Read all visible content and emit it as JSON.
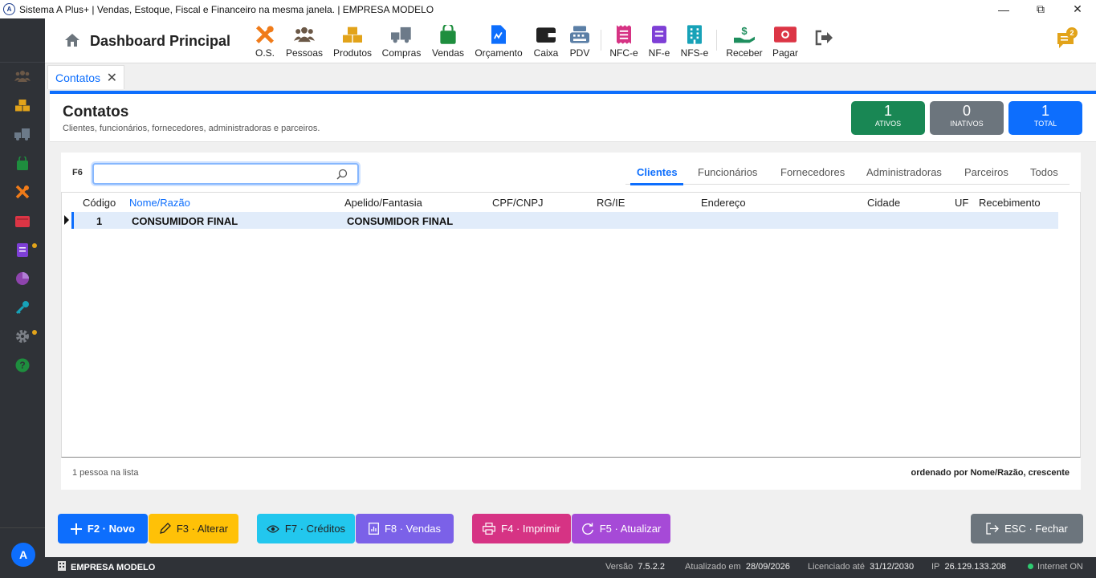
{
  "window": {
    "title": "Sistema A Plus+ | Vendas, Estoque, Fiscal e Financeiro na mesma janela. | EMPRESA MODELO",
    "minimize": "—",
    "maximize": "⧉",
    "close": "✕"
  },
  "header": {
    "title": "Dashboard Principal",
    "toolbar": [
      {
        "label": "O.S.",
        "icon": "tools-icon",
        "color": "#f07b19"
      },
      {
        "label": "Pessoas",
        "icon": "people-icon",
        "color": "#6b5847"
      },
      {
        "label": "Produtos",
        "icon": "boxes-icon",
        "color": "#e2a31a"
      },
      {
        "label": "Compras",
        "icon": "truck-icon",
        "color": "#6c7a89"
      },
      {
        "label": "Vendas",
        "icon": "shopping-bag-icon",
        "color": "#1e8e3e"
      },
      {
        "label": "Orçamento",
        "icon": "file-chart-icon",
        "color": "#0d6efd"
      },
      {
        "label": "Caixa",
        "icon": "wallet-icon",
        "color": "#222222"
      },
      {
        "label": "PDV",
        "icon": "cash-register-icon",
        "color": "#5b7fa6"
      },
      {
        "label": "NFC-e",
        "icon": "receipt-icon",
        "color": "#d63384"
      },
      {
        "label": "NF-e",
        "icon": "document-icon",
        "color": "#7e3fd6"
      },
      {
        "label": "NFS-e",
        "icon": "building-icon",
        "color": "#17a2b8"
      },
      {
        "label": "Receber",
        "icon": "hand-dollar-icon",
        "color": "#1e8e5e"
      },
      {
        "label": "Pagar",
        "icon": "money-icon",
        "color": "#dc3545"
      }
    ],
    "notifications_count": "2"
  },
  "tab": {
    "label": "Contatos",
    "close": "✕"
  },
  "page": {
    "title": "Contatos",
    "subtitle": "Clientes, funcionários, fornecedores, administradoras e parceiros.",
    "stats": [
      {
        "value": "1",
        "caption": "ATIVOS",
        "color": "#198754"
      },
      {
        "value": "0",
        "caption": "INATIVOS",
        "color": "#6c757d"
      },
      {
        "value": "1",
        "caption": "TOTAL",
        "color": "#0d6efd"
      }
    ]
  },
  "search": {
    "shortcut": "F6",
    "value": "",
    "placeholder": ""
  },
  "filters": {
    "active": "Clientes",
    "items": [
      "Clientes",
      "Funcionários",
      "Fornecedores",
      "Administradoras",
      "Parceiros",
      "Todos"
    ]
  },
  "grid": {
    "columns": [
      "Código",
      "Nome/Razão",
      "Apelido/Fantasia",
      "CPF/CNPJ",
      "RG/IE",
      "Endereço",
      "Cidade",
      "UF",
      "Recebimento"
    ],
    "sorted_column": "Nome/Razão",
    "rows": [
      {
        "codigo": "1",
        "nome": "CONSUMIDOR FINAL",
        "apelido": "CONSUMIDOR FINAL",
        "cpf": "",
        "rg": "",
        "endereco": "",
        "cidade": "",
        "uf": "",
        "recebimento": ""
      }
    ]
  },
  "footer": {
    "count": "1 pessoa na lista",
    "sort": "ordenado por Nome/Razão, crescente"
  },
  "actions": {
    "novo": "F2 · Novo",
    "alterar": "F3 · Alterar",
    "creditos": "F7 · Créditos",
    "vendas": "F8 · Vendas",
    "imprimir": "F4 · Imprimir",
    "atualizar": "F5 · Atualizar",
    "fechar": "ESC · Fechar"
  },
  "sidebar": {
    "avatar": "A"
  },
  "statusbar": {
    "company": "EMPRESA MODELO",
    "version_label": "Versão",
    "version": "7.5.2.2",
    "updated_label": "Atualizado em",
    "updated": "28/09/2026",
    "license_label": "Licenciado até",
    "license": "31/12/2030",
    "ip_label": "IP",
    "ip": "26.129.133.208",
    "internet": "Internet ON"
  }
}
